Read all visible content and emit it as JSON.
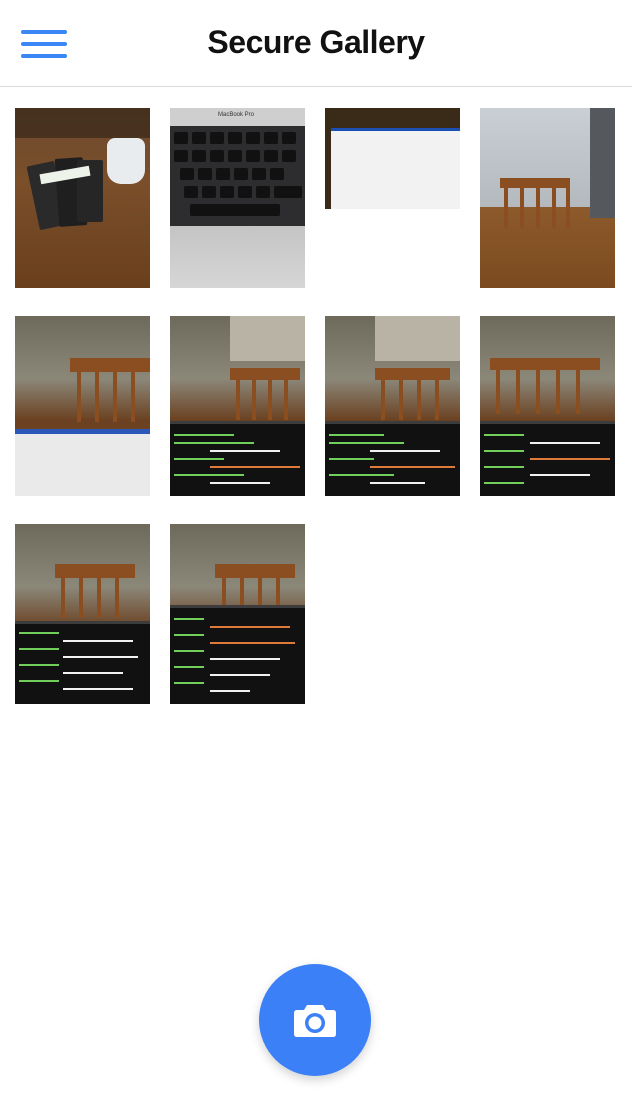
{
  "header": {
    "title": "Secure Gallery",
    "menu_icon": "hamburger-menu-icon"
  },
  "gallery": {
    "photos": [
      {
        "id": "photo-1",
        "subject": "juice-boxes-on-table"
      },
      {
        "id": "photo-2",
        "subject": "laptop-keyboard",
        "label": "MacBook Pro"
      },
      {
        "id": "photo-3",
        "subject": "laptop-screen"
      },
      {
        "id": "photo-4",
        "subject": "chair-and-table"
      },
      {
        "id": "photo-5",
        "subject": "kitchen-laptop-screen"
      },
      {
        "id": "photo-6",
        "subject": "kitchen-code-screen"
      },
      {
        "id": "photo-7",
        "subject": "kitchen-code-screen"
      },
      {
        "id": "photo-8",
        "subject": "kitchen-code-screen"
      },
      {
        "id": "photo-9",
        "subject": "kitchen-code-screen"
      },
      {
        "id": "photo-10",
        "subject": "kitchen-code-screen"
      }
    ]
  },
  "fab": {
    "icon": "camera-icon"
  },
  "colors": {
    "accent": "#3b80f7",
    "header_border": "#d9d9d9"
  }
}
